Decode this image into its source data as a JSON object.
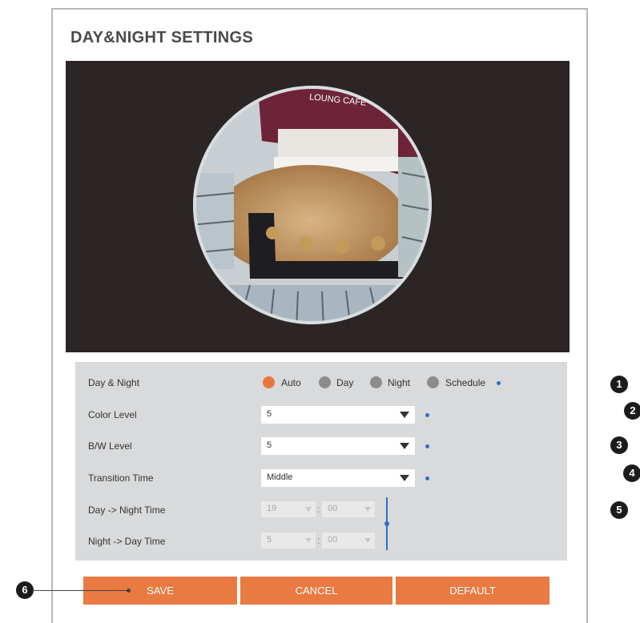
{
  "page": {
    "title": "DAY&NIGHT SETTINGS"
  },
  "video": {
    "sign_text": "LOUNG CAFE"
  },
  "form": {
    "day_night": {
      "label": "Day & Night",
      "options": [
        "Auto",
        "Day",
        "Night",
        "Schedule"
      ],
      "selected": "Auto"
    },
    "color_level": {
      "label": "Color Level",
      "value": "5"
    },
    "bw_level": {
      "label": "B/W Level",
      "value": "5"
    },
    "transition_time": {
      "label": "Transition Time",
      "value": "Middle"
    },
    "day_to_night": {
      "label": "Day -> Night Time",
      "hour": "19",
      "minute": "00",
      "separator": ":"
    },
    "night_to_day": {
      "label": "Night -> Day Time",
      "hour": "5",
      "minute": "00",
      "separator": ":"
    }
  },
  "buttons": {
    "save": "SAVE",
    "cancel": "CANCEL",
    "default": "DEFAULT"
  },
  "callouts": [
    "1",
    "2",
    "3",
    "4",
    "5",
    "6"
  ],
  "colors": {
    "accent_orange": "#e87a42",
    "callout_blue": "#2d6fc4",
    "form_bg": "#d9dadb",
    "video_bg": "#2b2625"
  },
  "icons": {
    "dropdown": "chevron-down-icon"
  }
}
